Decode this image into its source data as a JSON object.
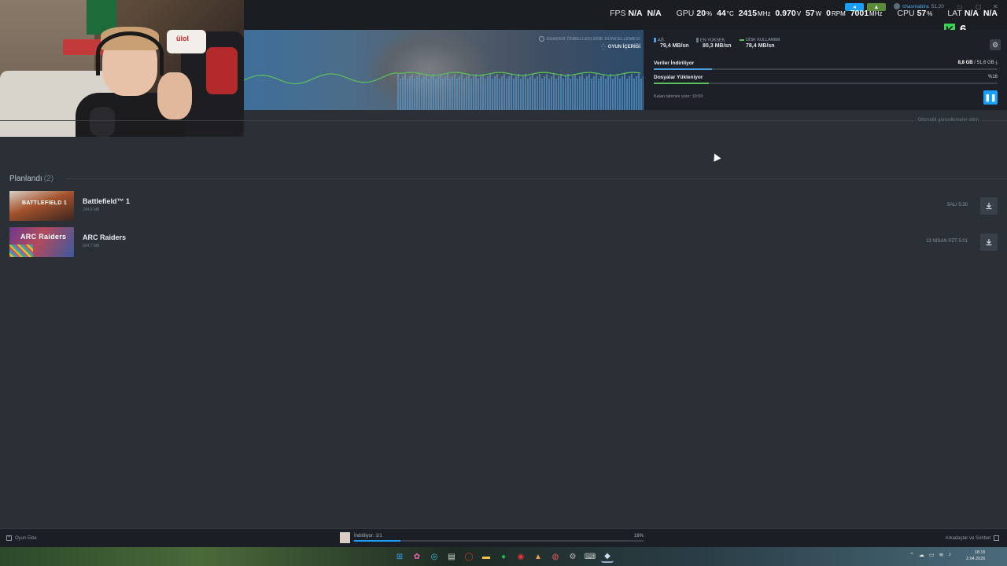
{
  "osd": {
    "fps_label": "FPS",
    "fps_val1": "N/A",
    "fps_val2": "N/A",
    "gpu_label": "GPU",
    "gpu_usage": "20",
    "gpu_usage_unit": "%",
    "gpu_temp": "44",
    "gpu_temp_unit": "°C",
    "gpu_clock": "2415",
    "gpu_clock_unit": "MHz",
    "gpu_volt": "0.970",
    "gpu_volt_unit": "V",
    "gpu_power": "57",
    "gpu_power_unit": "W",
    "gpu_fan": "0",
    "gpu_fan_unit": "RPM",
    "mem_clock": "7001",
    "mem_clock_unit": "MHz",
    "cpu_label": "CPU",
    "cpu_usage": "57",
    "cpu_usage_unit": "%",
    "lat_label": "LAT",
    "lat_val1": "N/A",
    "lat_val2": "N/A"
  },
  "user": {
    "name": "chasmabira",
    "balance": "51,20"
  },
  "overlay": {
    "k_letter": "K",
    "k_number": "6"
  },
  "webcam": {
    "pillow_text": "ülol"
  },
  "banner": {
    "shader_label": "SHADER ÖNBELLEKLEME GÜNCELLEMESİ",
    "content_label": "OYUN İÇERİĞİ"
  },
  "stats": {
    "network_label": "AĞ",
    "network_value": "79,4 MB/sn",
    "peak_label": "EN YÜKSEK",
    "peak_value": "80,3 MB/sn",
    "disk_label": "DİSK KULLANIMI",
    "disk_value": "78,4 MB/sn",
    "downloading_label": "Veriler İndiriliyor",
    "downloaded": "8,8 GB",
    "total": "51,6 GB",
    "download_progress": 0.17,
    "installing_label": "Dosyalar Yükleniyor",
    "installing_pct": "%16",
    "install_progress": 0.16,
    "remaining_label": "Kalan tahmini süre: 10:50"
  },
  "auto_updates": "Otomatik güncellemeler etkin",
  "scheduled": {
    "title": "Planlandı",
    "count": "(2)",
    "games": [
      {
        "name": "Battlefield™ 1",
        "size": "294,9 MB",
        "date": "SALI 5:30",
        "thumb_text": "BATTLEFIELD 1"
      },
      {
        "name": "ARC Raiders",
        "size": "654,7 MB",
        "date": "13 NİSAN PZT 5:01",
        "thumb_text": "ARC Raiders"
      }
    ]
  },
  "bottom": {
    "add_game": "Oyun Ekle",
    "downloading": "İndiriliyor: 1/1",
    "download_pct": "16%",
    "download_progress": 0.16,
    "friends": "Arkadaşlar ve Sohbet"
  },
  "taskbar": {
    "time": "18:16",
    "date": "2.04.2026"
  },
  "colors": {
    "accent": "#1a9fff",
    "green": "#5cc15a",
    "background": "#2b2f36"
  }
}
